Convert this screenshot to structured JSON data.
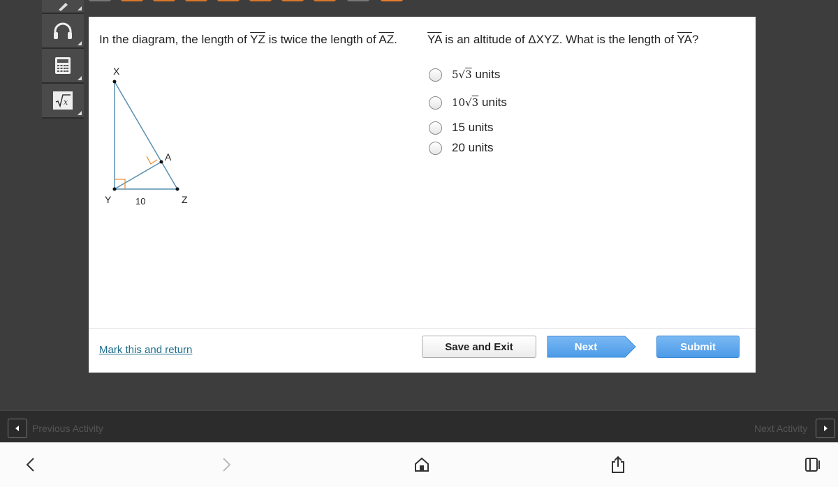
{
  "question": {
    "left_prefix": "In the diagram, the length of ",
    "seg1": "YZ",
    "left_middle": " is twice the length of ",
    "seg2": "AZ",
    "left_suffix": ".",
    "right_seg1": "YA",
    "right_middle": " is an altitude of ΔXYZ. What is the length of ",
    "right_seg2": "YA",
    "right_suffix": "?"
  },
  "diagram": {
    "labels": {
      "x": "X",
      "y": "Y",
      "z": "Z",
      "a": "A",
      "yz_length": "10"
    },
    "colors": {
      "line": "#5a8fb0",
      "right_angle": "#e8903a",
      "point": "#111111"
    }
  },
  "options": [
    {
      "coef": "5",
      "rad": "3",
      "unit": "units",
      "type": "radical"
    },
    {
      "coef": "10",
      "rad": "3",
      "unit": "units",
      "type": "radical"
    },
    {
      "text": "15 units",
      "type": "plain"
    },
    {
      "text": "20 units",
      "type": "plain"
    }
  ],
  "footer": {
    "mark_link": "Mark this and return",
    "save_exit": "Save and Exit",
    "next": "Next",
    "submit": "Submit"
  },
  "activity_bar": {
    "previous": "Previous Activity",
    "next": "Next Activity"
  },
  "toolbar": {
    "tools": [
      "pencil-icon",
      "headphones-icon",
      "calculator-icon",
      "formula-sqrt-icon"
    ]
  },
  "colors": {
    "accent_orange": "#e87b2c",
    "link": "#1f6e8c",
    "submit_blue": "#4c9be8"
  }
}
